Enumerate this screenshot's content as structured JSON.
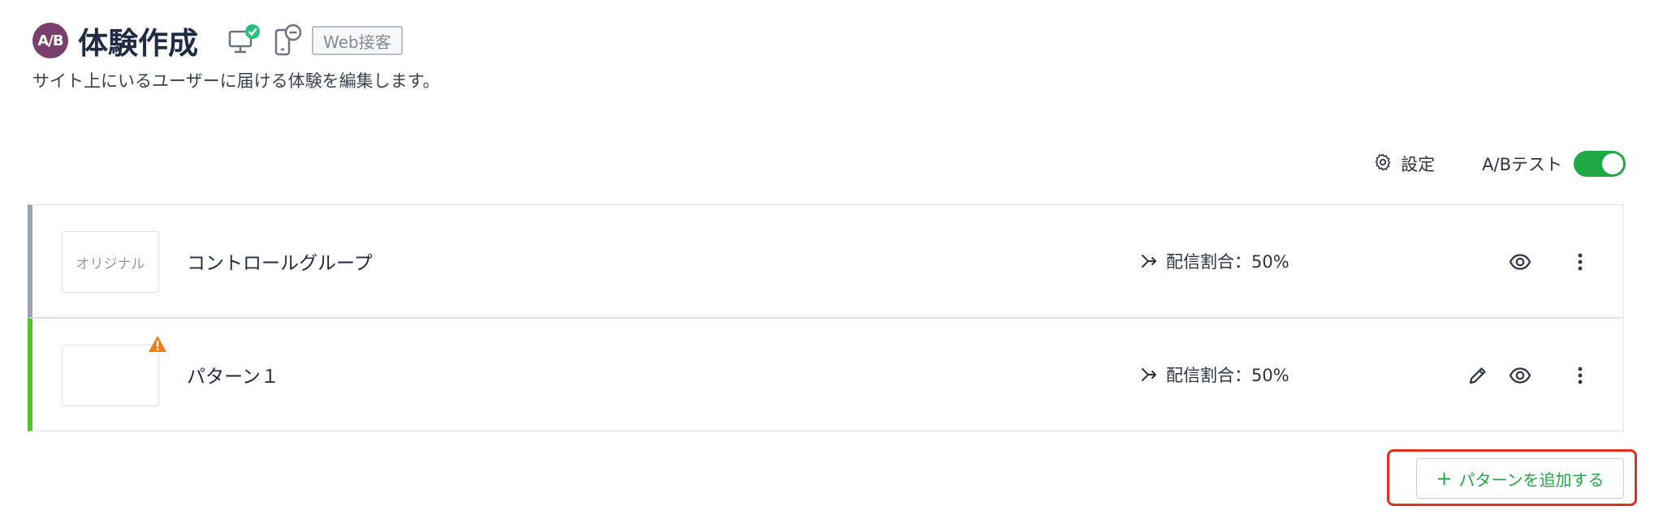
{
  "header": {
    "badge": "A/B",
    "title": "体験作成",
    "tag": "Web接客",
    "icons": [
      "desktop-check-icon",
      "mobile-minus-icon"
    ]
  },
  "subtitle": "サイト上にいるユーザーに届ける体験を編集します。",
  "controls": {
    "settings_label": "設定",
    "ab_test_label": "A/Bテスト",
    "ab_test_enabled": true
  },
  "patterns": [
    {
      "thumb_label": "オリジナル",
      "name": "コントロールグループ",
      "ratio": "配信割合：50%",
      "accent": "#9aa3b5",
      "actions": [
        "eye-icon",
        "more-vertical-icon"
      ]
    },
    {
      "thumb_label": "",
      "name": "パターン１",
      "ratio": "配信割合：50%",
      "accent": "#55c22e",
      "warning": true,
      "actions": [
        "pencil-icon",
        "eye-icon",
        "more-vertical-icon"
      ]
    }
  ],
  "add_button": {
    "plus": "+",
    "label": "パターンを追加する"
  },
  "colors": {
    "primary_green": "#1fa843",
    "badge_purple": "#7b3f6e",
    "highlight_red": "#e0311c",
    "warning_orange": "#f07e16"
  }
}
